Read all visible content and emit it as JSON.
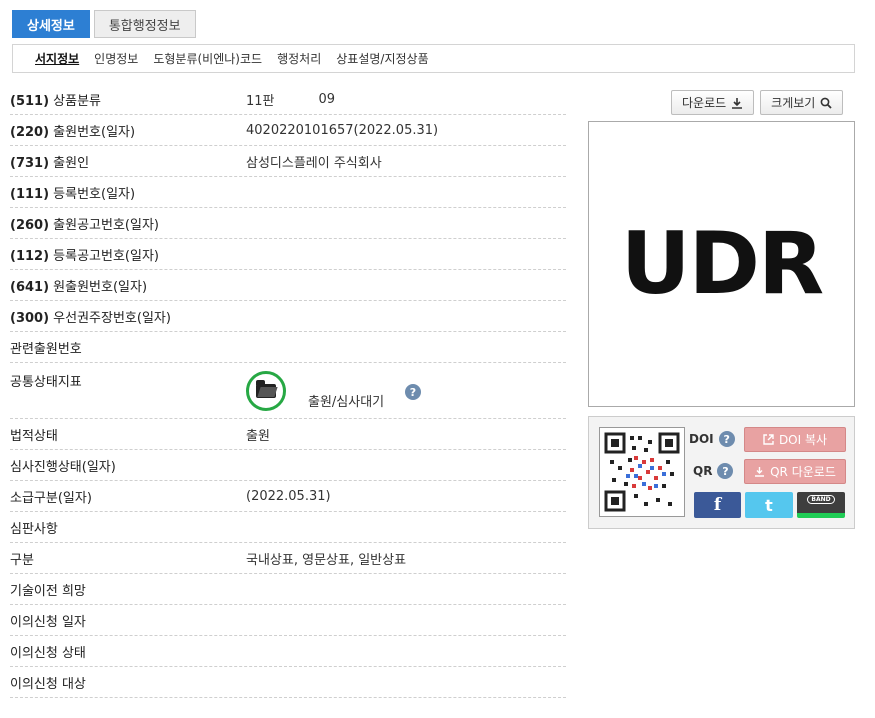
{
  "top_tabs": [
    {
      "label": "상세정보",
      "active": true
    },
    {
      "label": "통합행정정보",
      "active": false
    }
  ],
  "sub_tabs": [
    "서지정보",
    "인명정보",
    "도형분류(비엔나)코드",
    "행정처리",
    "상표설명/지정상품"
  ],
  "fields": {
    "class": {
      "code": "(511)",
      "label": "상품분류",
      "edition": "11판",
      "number": "09"
    },
    "app_no": {
      "code": "(220)",
      "label": "출원번호(일자)",
      "value": "4020220101657(2022.05.31)"
    },
    "applicant": {
      "code": "(731)",
      "label": "출원인",
      "value": "삼성디스플레이 주식회사"
    },
    "reg_no": {
      "code": "(111)",
      "label": "등록번호(일자)",
      "value": ""
    },
    "pub_no": {
      "code": "(260)",
      "label": "출원공고번호(일자)",
      "value": ""
    },
    "reg_pub_no": {
      "code": "(112)",
      "label": "등록공고번호(일자)",
      "value": ""
    },
    "orig_app_no": {
      "code": "(641)",
      "label": "원출원번호(일자)",
      "value": ""
    },
    "priority_no": {
      "code": "(300)",
      "label": "우선권주장번호(일자)",
      "value": ""
    },
    "related": {
      "label": "관련출원번호",
      "value": ""
    },
    "common_status": {
      "label": "공통상태지표",
      "value": "출원/심사대기"
    },
    "legal_status": {
      "label": "법적상태",
      "value": "출원"
    },
    "appeal_progress": {
      "label": "심사진행상태(일자)",
      "value": ""
    },
    "retro": {
      "label": "소급구분(일자)",
      "value": "(2022.05.31)"
    },
    "trial": {
      "label": "심판사항",
      "value": ""
    },
    "division": {
      "label": "구분",
      "value": "국내상표, 영문상표, 일반상표"
    },
    "tech_transfer": {
      "label": "기술이전 희망",
      "value": ""
    },
    "objection_date": {
      "label": "이의신청 일자",
      "value": ""
    },
    "objection_status": {
      "label": "이의신청 상태",
      "value": ""
    },
    "objection_target": {
      "label": "이의신청 대상",
      "value": ""
    }
  },
  "buttons": {
    "download": "다운로드",
    "zoom": "크게보기"
  },
  "mark_text": "UDR",
  "share": {
    "doi_label": "DOI",
    "qr_label": "QR",
    "doi_copy": "DOI 복사",
    "qr_download": "QR 다운로드",
    "help": "?",
    "facebook": "f",
    "twitter": "t",
    "band": "BAND"
  },
  "colors": {
    "tab_active": "#2d7fd3",
    "status_green": "#27a844",
    "pink_button": "#e8a2a2",
    "facebook": "#3b5998",
    "twitter": "#55c7ee",
    "band": "#3e3e3e"
  }
}
